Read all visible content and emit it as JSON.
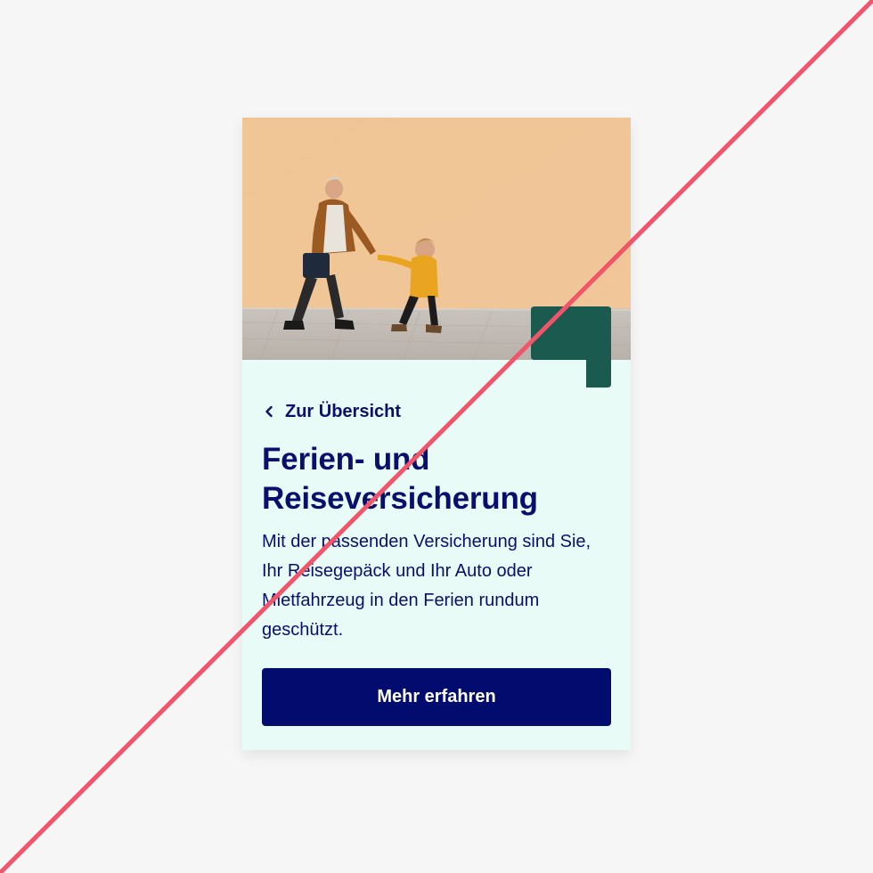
{
  "card": {
    "hero_image_icon": "photo-family-walking",
    "back_link": {
      "label": "Zur Übersicht",
      "icon": "chevron-left-icon"
    },
    "title": "Ferien- und Reiseversicherung",
    "description": "Mit der passenden Versicherung sind Sie, Ihr Reisegepäck und Ihr Auto oder Mietfahrzeug in den Ferien rundum geschützt.",
    "cta_label": "Mehr erfahren"
  },
  "colors": {
    "page_background": "#f6f6f7",
    "card_background": "#e8fbf7",
    "text_primary": "#0a0f6e",
    "cta_background": "#020b6e",
    "brand_mark": "#1b5a4f",
    "strike_line": "#f2546a"
  }
}
